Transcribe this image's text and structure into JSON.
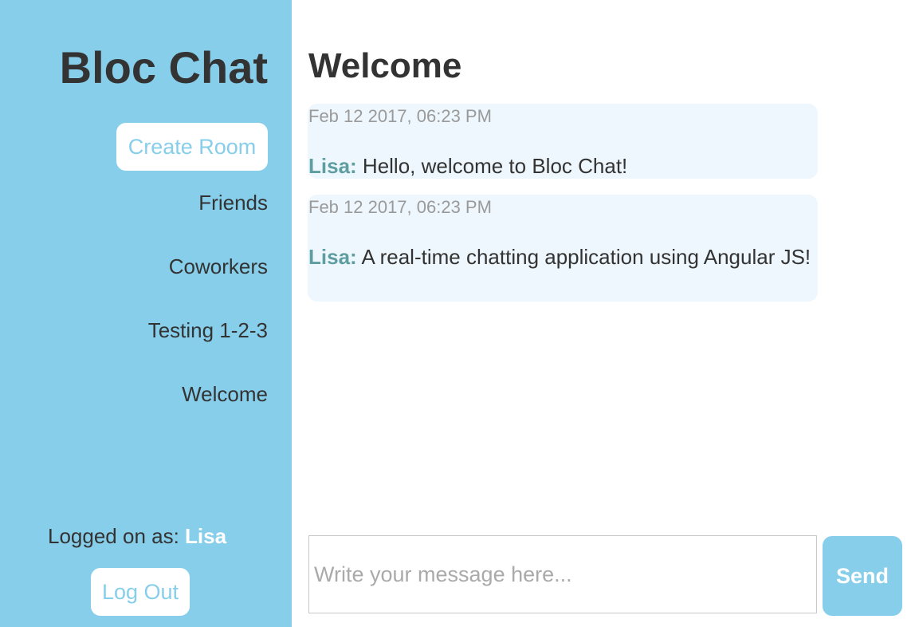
{
  "app": {
    "brand": "Bloc Chat"
  },
  "sidebar": {
    "create_room_label": "Create Room",
    "rooms": [
      {
        "label": "Friends"
      },
      {
        "label": "Coworkers"
      },
      {
        "label": "Testing 1-2-3"
      },
      {
        "label": "Welcome"
      }
    ],
    "logged_prefix": "Logged on as: ",
    "logged_user": "Lisa",
    "logout_label": "Log Out"
  },
  "main": {
    "room_title": "Welcome",
    "messages": [
      {
        "time": "Feb 12 2017, 06:23 PM",
        "user": "Lisa:",
        "text": " Hello, welcome to Bloc Chat!"
      },
      {
        "time": "Feb 12 2017, 06:23 PM",
        "user": "Lisa:",
        "text": " A real-time chatting application using Angular JS!"
      }
    ],
    "composer": {
      "placeholder": "Write your message here...",
      "value": ""
    },
    "send_label": "Send"
  },
  "colors": {
    "sidebar_bg": "#87ceeb",
    "accent": "#87ceeb",
    "username": "#5f9ea0",
    "message_bg": "#eef7fd",
    "timestamp": "#9a9a9a"
  }
}
